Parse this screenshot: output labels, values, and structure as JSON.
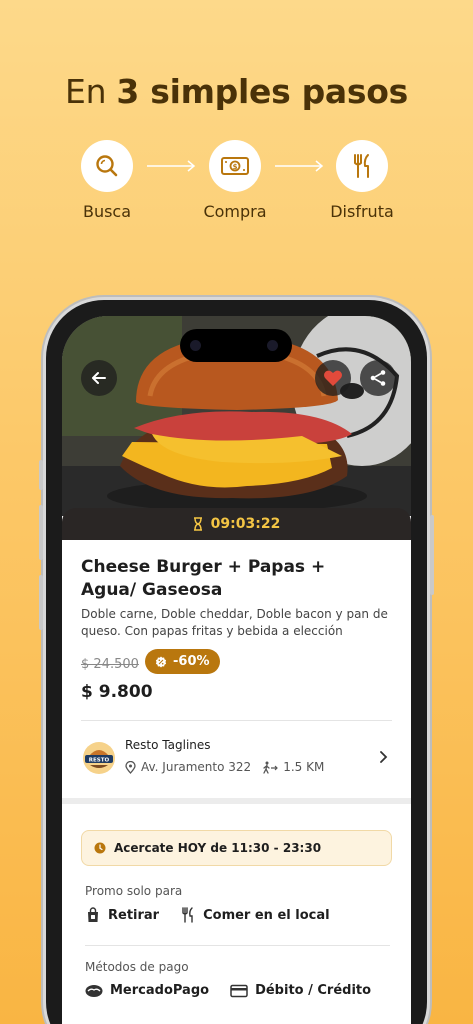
{
  "headline": {
    "prefix": "En ",
    "bold": "3 simples pasos"
  },
  "steps": [
    {
      "label": "Busca",
      "icon": "search-icon"
    },
    {
      "label": "Compra",
      "icon": "money-icon"
    },
    {
      "label": "Disfruta",
      "icon": "utensils-icon"
    }
  ],
  "offer": {
    "timer": "09:03:22",
    "title": "Cheese Burger + Papas + Agua/ Gaseosa",
    "description": "Doble carne, Doble cheddar, Doble bacon y pan de queso. Con papas fritas y bebida a elección",
    "old_price": "$ 24.500",
    "discount": "-60%",
    "price": "$ 9.800"
  },
  "restaurant": {
    "name": "Resto Taglines",
    "logo_text": "RESTO",
    "address": "Av. Juramento 322",
    "distance": "1.5 KM"
  },
  "pickup_notice": "Acercate HOY de 11:30 - 23:30",
  "promo": {
    "label": "Promo solo para",
    "options": [
      "Retirar",
      "Comer en el local"
    ]
  },
  "payment": {
    "label": "Métodos de pago",
    "methods": [
      "MercadoPago",
      "Débito / Crédito"
    ]
  },
  "colors": {
    "accent": "#b9770e",
    "timer": "#f4c544",
    "heart": "#e24a3b",
    "background_top": "#fdd98a",
    "background_bottom": "#f9b543"
  }
}
